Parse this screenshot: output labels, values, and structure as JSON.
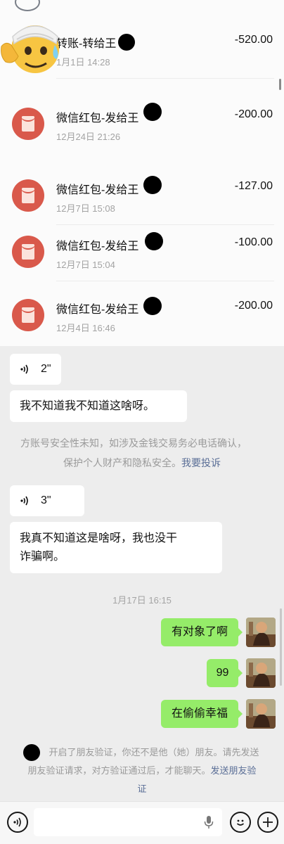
{
  "transactions": [
    {
      "title": "转账-转给王",
      "date": "1月1日 14:28",
      "amount": "-520.00",
      "icon": "transfer-icon"
    },
    {
      "title": "微信红包-发给王",
      "date": "12月24日 21:26",
      "amount": "-200.00",
      "icon": "red-packet-icon"
    },
    {
      "title": "微信红包-发给王",
      "date": "12月7日 15:08",
      "amount": "-127.00",
      "icon": "red-packet-icon"
    },
    {
      "title": "微信红包-发给王",
      "date": "12月7日 15:04",
      "amount": "-100.00",
      "icon": "red-packet-icon"
    },
    {
      "title": "微信红包-发给王",
      "date": "12月4日 16:46",
      "amount": "-200.00",
      "icon": "red-packet-icon"
    }
  ],
  "chat": {
    "voice_1": "2\"",
    "message_1": "我不知道我不知道这啥呀。",
    "warning_line_1": "方账号安全性未知，如涉及金钱交易务必电话确认，",
    "warning_line_2": "保护个人财产和隐私安全。",
    "warning_link": "我要投诉",
    "voice_2": "3\"",
    "message_2_line_1": "我真不知道这是啥呀，我也没干",
    "message_2_line_2": "诈骗啊。",
    "timestamp": "1月17日 16:15",
    "sent": [
      "有对象了啊",
      "99",
      "在偷偷幸福"
    ],
    "verify_line_1": "开启了朋友验证，你还不是他（她）朋友。请先发送",
    "verify_line_2_prefix": "朋友验证请求，对方验证通过后，才能聊天。",
    "verify_link_1": "发送朋友验",
    "verify_link_2": "证"
  },
  "input_bar": {
    "voice_button": "voice-toggle-icon",
    "mic_icon": "microphone-icon",
    "emoji_button": "emoji-icon",
    "plus_button": "plus-icon"
  },
  "colors": {
    "red_packet": "#d9594b",
    "sent_bubble": "#95ec69",
    "link": "#5a6e96",
    "chat_bg": "#ededed"
  }
}
